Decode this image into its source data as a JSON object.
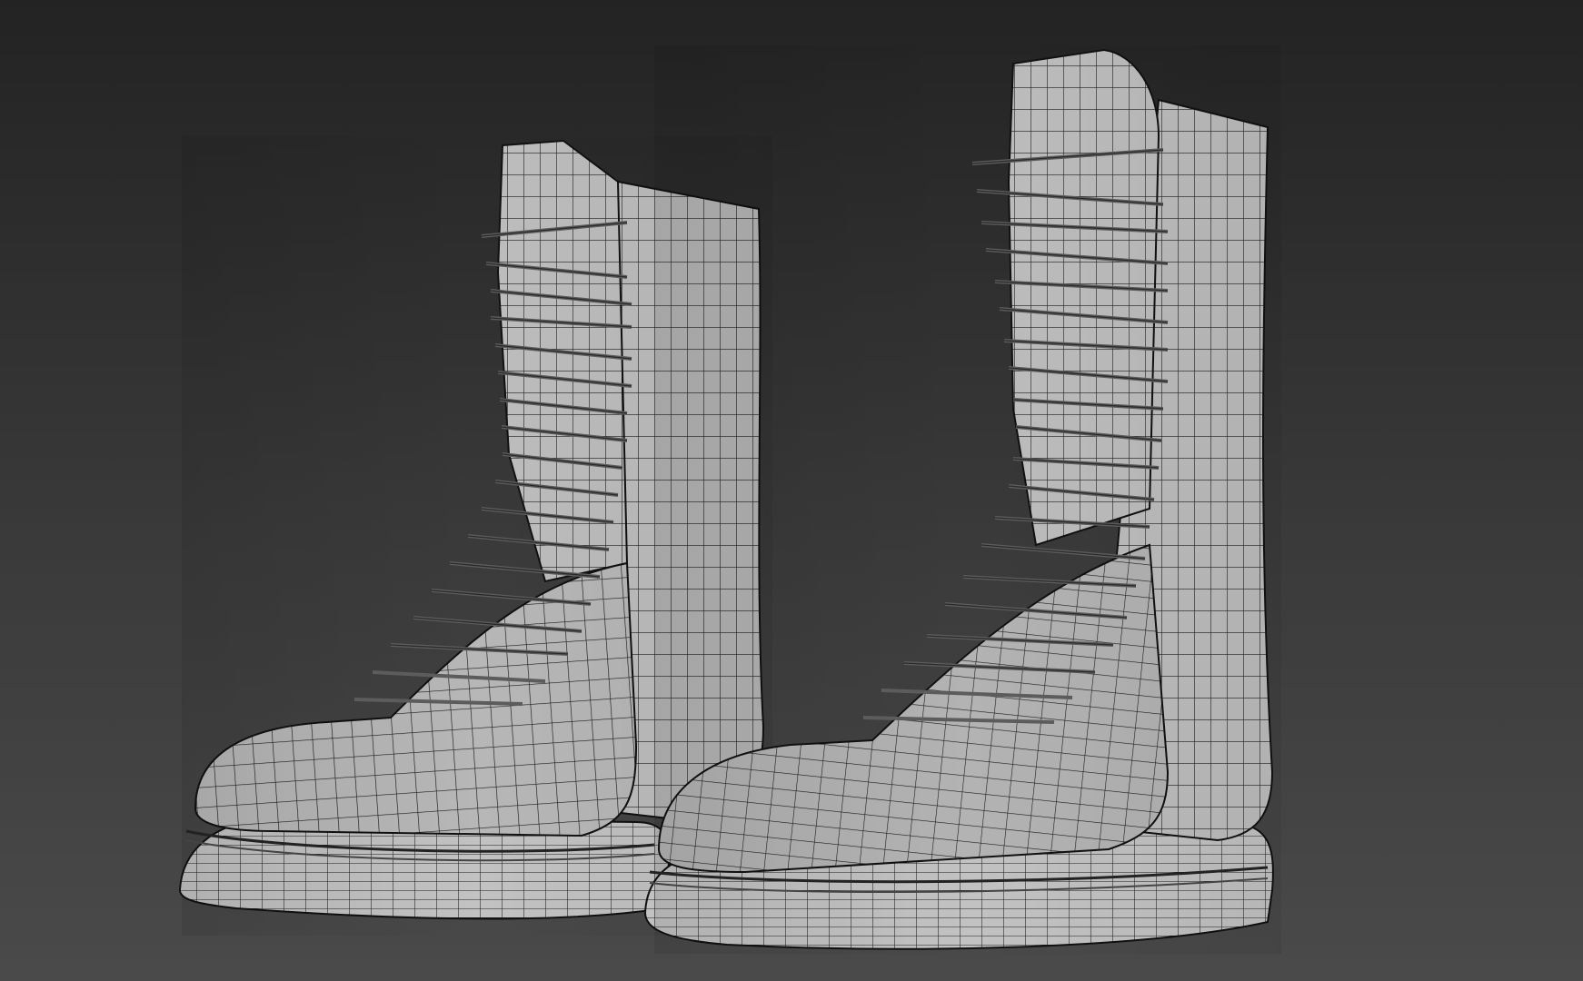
{
  "viewport": {
    "background_top": "#232323",
    "background_bottom": "#4a4a4a"
  },
  "model": {
    "objects": [
      {
        "id": "boot-left",
        "shading": "wireframe-on-shaded"
      },
      {
        "id": "boot-right",
        "shading": "wireframe-on-shaded"
      }
    ],
    "surface_color": "#b9b9b9",
    "wire_color": "#1a1a1a",
    "lace_color": "#6e6e6e"
  }
}
